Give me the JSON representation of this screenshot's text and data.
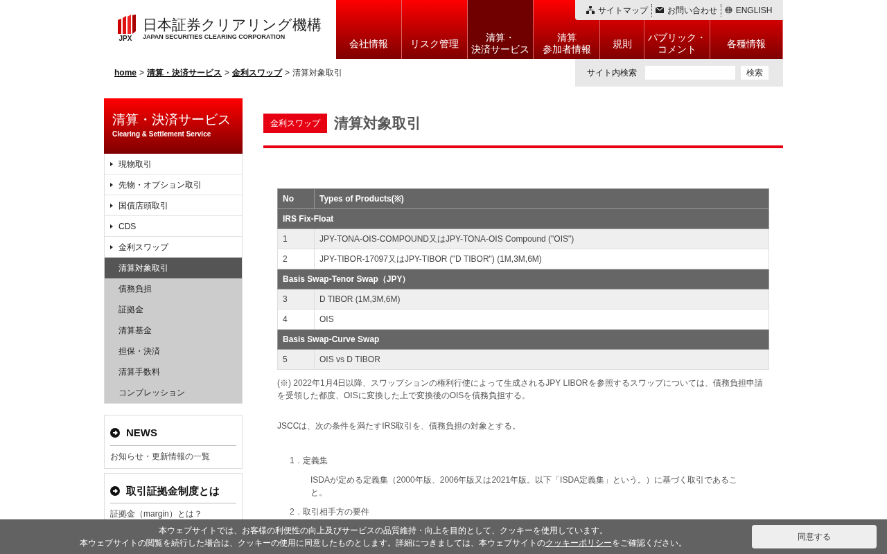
{
  "header": {
    "logo": {
      "name_ja": "日本証券クリアリング機構",
      "name_en": "JAPAN SECURITIES CLEARING CORPORATION",
      "mark": "JPX"
    },
    "utility_links": [
      {
        "kind": "sitemap",
        "label": "サイトマップ"
      },
      {
        "kind": "mail",
        "label": "お問い合わせ"
      },
      {
        "kind": "globe",
        "label": "ENGLISH"
      }
    ],
    "nav": [
      {
        "lines": [
          "会社情報"
        ],
        "selected": false
      },
      {
        "lines": [
          "リスク管理"
        ],
        "selected": false
      },
      {
        "lines": [
          "清算・",
          "決済サービス"
        ],
        "selected": true
      },
      {
        "lines": [
          "清算",
          "参加者情報"
        ],
        "selected": false
      },
      {
        "lines": [
          "規則"
        ],
        "selected": false
      },
      {
        "lines": [
          "パブリック・",
          "コメント"
        ],
        "selected": false
      },
      {
        "lines": [
          "各種情報"
        ],
        "selected": false
      }
    ],
    "search": {
      "label": "サイト内検索",
      "button": "検索"
    }
  },
  "breadcrumb": {
    "separator": ">",
    "links": [
      "home",
      "清算・決済サービス",
      "金利スワップ"
    ],
    "current": "清算対象取引"
  },
  "sidebar": {
    "title": "清算・決済サービス",
    "subtitle": "Clearing & Settlement Service",
    "items": [
      {
        "label": "現物取引"
      },
      {
        "label": "先物・オプション取引"
      },
      {
        "label": "国債店頭取引"
      },
      {
        "label": "CDS"
      },
      {
        "label": "金利スワップ",
        "children": [
          {
            "label": "清算対象取引",
            "selected": true
          },
          {
            "label": "債務負担",
            "selected": false
          },
          {
            "label": "証拠金",
            "selected": false
          },
          {
            "label": "清算基金",
            "selected": false
          },
          {
            "label": "担保・決済",
            "selected": false
          },
          {
            "label": "清算手数料",
            "selected": false
          },
          {
            "label": "コンプレッション",
            "selected": false
          }
        ]
      }
    ],
    "widgets": [
      {
        "title": "NEWS",
        "link": "お知らせ・更新情報の一覧"
      },
      {
        "title": "取引証拠金制度とは",
        "link": "証拠金（margin）とは？"
      }
    ]
  },
  "main": {
    "tag": "金利スワップ",
    "title": "清算対象取引",
    "table": {
      "columns": [
        "No",
        "Types of Products(※)"
      ],
      "groups": [
        {
          "title": "IRS Fix-Float",
          "rows": [
            [
              "1",
              "JPY-TONA-OIS-COMPOUND又はJPY-TONA-OIS Compound (\"OIS\")"
            ],
            [
              "2",
              "JPY-TIBOR-17097又はJPY-TIBOR (\"D TIBOR\") (1M,3M,6M)"
            ]
          ]
        },
        {
          "title": "Basis Swap-Tenor Swap（JPY）",
          "rows": [
            [
              "3",
              "D TIBOR (1M,3M,6M)"
            ],
            [
              "4",
              "OIS"
            ]
          ]
        },
        {
          "title": "Basis Swap-Curve Swap",
          "rows": [
            [
              "5",
              "OIS vs D TIBOR"
            ]
          ]
        }
      ]
    },
    "footnote": "(※) 2022年1月4日以降、スワップションの権利行使によって生成されるJPY LIBORを参照するスワップについては、債務負担申請を受領した都度、OISに変換した上で変換後のOISを債務負担する。",
    "intro": "JSCCは、次の条件を満たすIRS取引を、債務負担の対象とする。",
    "conditions": [
      {
        "heading": "1．定義集",
        "body": "ISDAが定める定義集（2000年版、2006年版又は2021年版。以下「ISDA定義集」という。）に基づく取引であること。"
      },
      {
        "heading": "2．取引相手方の要件"
      }
    ]
  },
  "cookie_banner": {
    "line1": "本ウェブサイトでは、お客様の利便性の向上及びサービスの品質維持・向上を目的として、クッキーを使用しています。",
    "line2_before": "本ウェブサイトの閲覧を続行した場合は、クッキーの使用に同意したものとします。詳細につきましては、本ウェブサイトの",
    "link": "クッキーポリシー",
    "line2_after": "をご確認ください。",
    "button": "同意する"
  }
}
